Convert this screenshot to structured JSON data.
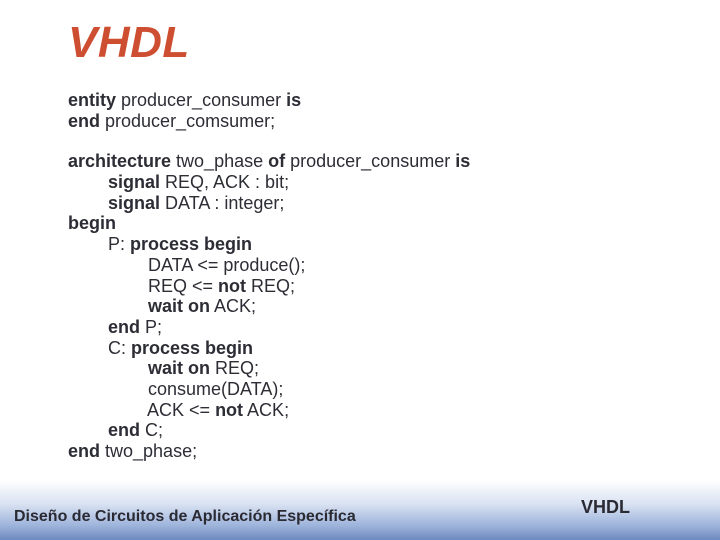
{
  "title": "VHDL",
  "code": {
    "l1a": "entity",
    "l1b": " producer_consumer ",
    "l1c": "is",
    "l2": "end",
    "l2b": " producer_comsumer;",
    "l3a": "architecture",
    "l3b": " two_phase ",
    "l3c": "of",
    "l3d": " producer_consumer ",
    "l3e": "is",
    "l4a": "        signal",
    "l4b": " REQ, ACK : bit;",
    "l5a": "        signal",
    "l5b": " DATA : integer;",
    "l6": "begin",
    "l7a": "        P: ",
    "l7b": "process begin",
    "l8": "                DATA <= produce();",
    "l9": "                REQ <= ",
    "l9b": "not",
    "l9c": " REQ;",
    "l10a": "                wait on",
    "l10b": " ACK;",
    "l11": "        end",
    "l11b": " P;",
    "l12a": "        C: ",
    "l12b": "process begin",
    "l13a": "                wait on",
    "l13b": " REQ;",
    "l14": "                consume(DATA);",
    "l15a": "                ACK <= ",
    "l15b": "not",
    "l15c": " ACK;",
    "l16": "        end",
    "l16b": " C;",
    "l17": "end",
    "l17b": " two_phase;"
  },
  "footer": {
    "left": "Diseño de Circuitos de Aplicación Específica",
    "right": "VHDL"
  }
}
